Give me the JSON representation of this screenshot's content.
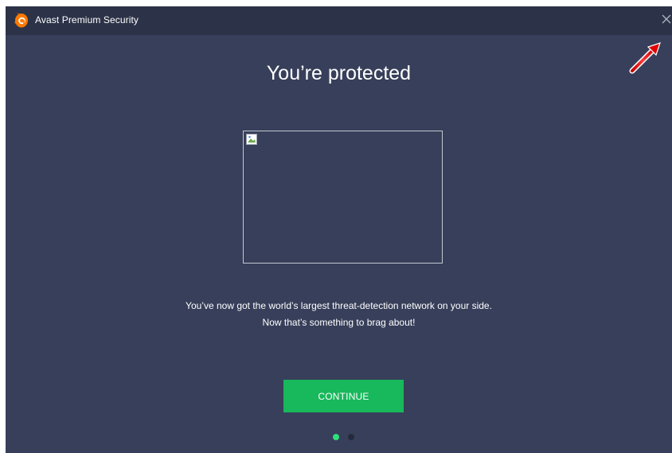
{
  "window": {
    "title": "Avast Premium Security",
    "background_color": "#373f5a",
    "titlebar_color": "#2c3348"
  },
  "icons": {
    "logo": "avast-logo-icon",
    "close": "close-icon",
    "annotation": "red-arrow-annotation",
    "broken_image": "broken-image-icon"
  },
  "main": {
    "heading": "You’re protected",
    "description_line1": "You’ve now got the world’s largest threat-detection network on your side.",
    "description_line2": "Now that’s something to brag about!",
    "continue_label": "CONTINUE",
    "continue_color": "#18b85c"
  },
  "pagination": {
    "total": 2,
    "active": 1,
    "active_color": "#2ee07a",
    "inactive_color": "#232a3d"
  }
}
